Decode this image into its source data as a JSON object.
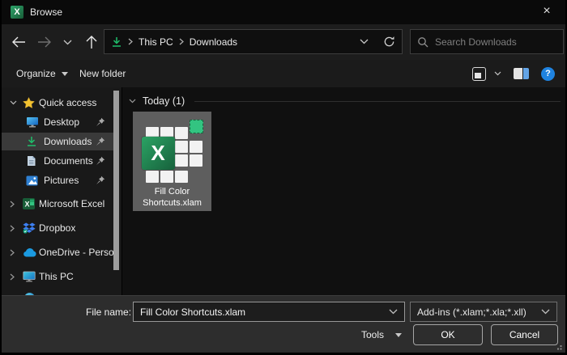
{
  "window": {
    "title": "Browse",
    "close_glyph": "×"
  },
  "navbar": {
    "address": {
      "root": "This PC",
      "current": "Downloads"
    },
    "search_placeholder": "Search Downloads"
  },
  "toolbar": {
    "organize_label": "Organize",
    "new_folder_label": "New folder",
    "help_glyph": "?"
  },
  "sidebar": {
    "quick_access_label": "Quick access",
    "items_quick": [
      {
        "label": "Desktop"
      },
      {
        "label": "Downloads"
      },
      {
        "label": "Documents"
      },
      {
        "label": "Pictures"
      }
    ],
    "items_roots": [
      {
        "label": "Microsoft Excel"
      },
      {
        "label": "Dropbox"
      },
      {
        "label": "OneDrive - Person"
      },
      {
        "label": "This PC"
      }
    ]
  },
  "main": {
    "group_label": "Today (1)",
    "file_name": "Fill Color Shortcuts.xlam",
    "excel_glyph": "X"
  },
  "footer": {
    "file_name_label": "File name:",
    "file_name_value": "Fill Color Shortcuts.xlam",
    "file_type_value": "Add-ins (*.xlam;*.xla;*.xll)",
    "tools_label": "Tools",
    "ok_label": "OK",
    "cancel_label": "Cancel"
  },
  "colors": {
    "excel_green_dark": "#185c37",
    "excel_green_light": "#33c481",
    "download_green": "#1fbf6b",
    "accent_blue": "#1f83e0",
    "selection_gray": "#5e5e5e",
    "footer_bg": "#2d2d2d"
  }
}
